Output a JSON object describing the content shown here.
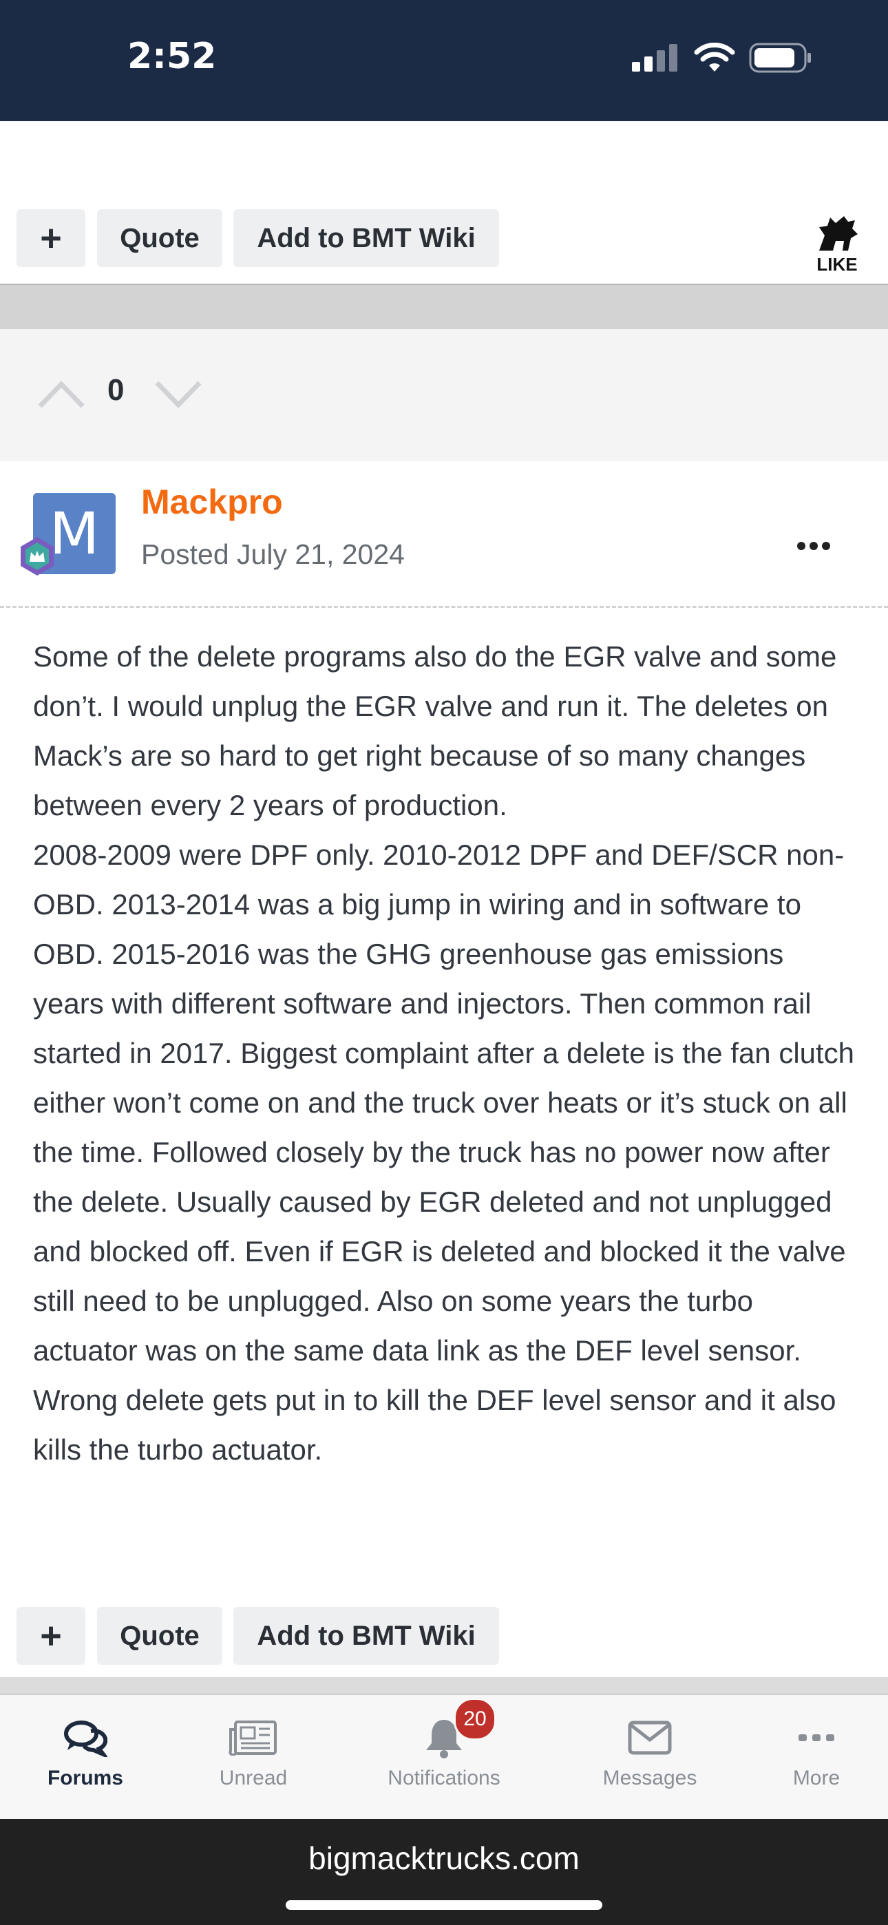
{
  "status_bar": {
    "time": "2:52"
  },
  "top_actions": {
    "plus": "+",
    "quote": "Quote",
    "wiki": "Add to BMT Wiki",
    "like": "LIKE"
  },
  "vote": {
    "count": "0"
  },
  "post": {
    "author": "Mackpro",
    "avatar_letter": "M",
    "posted": "Posted July 21, 2024",
    "body": "Some of the delete programs also do the EGR valve and some don’t. I would unplug the EGR valve and run it. The deletes on Mack’s are so hard to get right because of so many changes between every 2 years of production.\n 2008-2009 were DPF only. 2010-2012  DPF and DEF/SCR non-OBD. 2013-2014 was a big jump in wiring and in software to OBD. 2015-2016 was the GHG greenhouse gas emissions years with different software and injectors. Then common rail started in 2017. Biggest complaint after a delete is the fan clutch either won’t come on and the truck over heats or it’s stuck on all the time. Followed closely by the truck has no power now after the delete. Usually caused by EGR deleted and not unplugged and blocked off. Even if EGR is deleted and blocked it the valve still  need to be unplugged. Also on some years the turbo actuator was on the same data link as the DEF level sensor. Wrong delete gets put in to kill the DEF level sensor and it also kills the turbo actuator."
  },
  "bottom_actions": {
    "plus": "+",
    "quote": "Quote",
    "wiki": "Add to BMT Wiki"
  },
  "tabs": [
    {
      "label": "Forums",
      "icon": "forums-icon",
      "active": true
    },
    {
      "label": "Unread",
      "icon": "unread-icon"
    },
    {
      "label": "Notifications",
      "icon": "bell-icon",
      "badge": "20"
    },
    {
      "label": "Messages",
      "icon": "envelope-icon"
    },
    {
      "label": "More",
      "icon": "more-icon"
    }
  ],
  "browser": {
    "url": "bigmacktrucks.com"
  },
  "colors": {
    "author": "#f36a10",
    "status_bar": "#1c2b45",
    "avatar": "#5a82c6",
    "badge": "#c0302a"
  }
}
